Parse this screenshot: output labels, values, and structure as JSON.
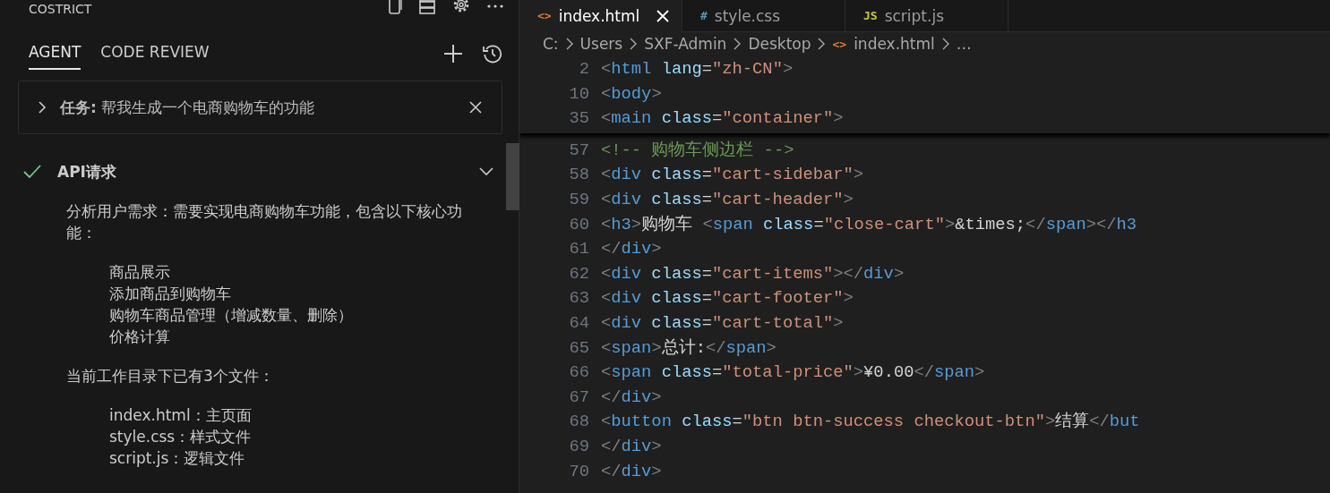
{
  "agent_panel": {
    "title": "COSTRICT",
    "tabs": [
      {
        "label": "AGENT",
        "selected": true
      },
      {
        "label": "CODE REVIEW",
        "selected": false
      }
    ],
    "task": {
      "expanded": false,
      "text": "**任务:** 帮我生成一个电商购物车的功能"
    },
    "section": {
      "title": "API请求",
      "completed": true,
      "expanded": true,
      "blocks": [
        {
          "kind": "paragraph",
          "text": "分析用户需求：需要实现电商购物车功能，包含以下核心功能："
        },
        {
          "kind": "list",
          "items": [
            "商品展示",
            "添加商品到购物车",
            "购物车商品管理（增减数量、删除）",
            "价格计算"
          ]
        },
        {
          "kind": "paragraph",
          "text": "当前工作目录下已有3个文件："
        },
        {
          "kind": "list",
          "items": [
            "index.html：主页面",
            "style.css：样式文件",
            "script.js：逻辑文件"
          ]
        }
      ]
    }
  },
  "editor": {
    "tabs": [
      {
        "label": "index.html",
        "kind": "html",
        "icon": "<>",
        "selected": true
      },
      {
        "label": "style.css",
        "kind": "css",
        "icon": "#",
        "selected": false
      },
      {
        "label": "script.js",
        "kind": "js",
        "icon": "JS",
        "selected": false
      }
    ],
    "breadcrumb": [
      {
        "text": "C:",
        "kind": "folder"
      },
      {
        "text": "Users",
        "kind": "folder"
      },
      {
        "text": "SXF-Admin",
        "kind": "folder"
      },
      {
        "text": "Desktop",
        "kind": "folder"
      },
      {
        "text": "index.html",
        "kind": "file",
        "icon": "<>"
      },
      {
        "text": "…",
        "kind": "more"
      }
    ],
    "sticky_lines": [
      {
        "number": "2",
        "tokens": [
          {
            "kind": "punct",
            "text": "<"
          },
          {
            "kind": "tag",
            "text": "html"
          },
          {
            "kind": "attr",
            "text": " lang"
          },
          {
            "kind": "text",
            "text": "="
          },
          {
            "kind": "string",
            "text": "\"zh-CN\""
          },
          {
            "kind": "punct",
            "text": ">"
          }
        ]
      },
      {
        "number": "10",
        "tokens": [
          {
            "kind": "punct",
            "text": "<"
          },
          {
            "kind": "tag",
            "text": "body"
          },
          {
            "kind": "punct",
            "text": ">"
          }
        ]
      },
      {
        "number": "35",
        "tokens": [
          {
            "kind": "punct",
            "text": "    <"
          },
          {
            "kind": "tag",
            "text": "main"
          },
          {
            "kind": "attr",
            "text": " class"
          },
          {
            "kind": "text",
            "text": "="
          },
          {
            "kind": "string",
            "text": "\"container\""
          },
          {
            "kind": "punct",
            "text": ">"
          }
        ]
      }
    ],
    "lines": [
      {
        "number": "57",
        "tokens": [
          {
            "kind": "comment",
            "text": "        <!-- 购物车侧边栏 -->"
          }
        ]
      },
      {
        "number": "58",
        "tokens": [
          {
            "kind": "punct",
            "text": "        <"
          },
          {
            "kind": "tag",
            "text": "div"
          },
          {
            "kind": "attr",
            "text": " class"
          },
          {
            "kind": "text",
            "text": "="
          },
          {
            "kind": "string",
            "text": "\"cart-sidebar\""
          },
          {
            "kind": "punct",
            "text": ">"
          }
        ]
      },
      {
        "number": "59",
        "tokens": [
          {
            "kind": "punct",
            "text": "            <"
          },
          {
            "kind": "tag",
            "text": "div"
          },
          {
            "kind": "attr",
            "text": " class"
          },
          {
            "kind": "text",
            "text": "="
          },
          {
            "kind": "string",
            "text": "\"cart-header\""
          },
          {
            "kind": "punct",
            "text": ">"
          }
        ]
      },
      {
        "number": "60",
        "tokens": [
          {
            "kind": "punct",
            "text": "                <"
          },
          {
            "kind": "tag",
            "text": "h3"
          },
          {
            "kind": "punct",
            "text": ">"
          },
          {
            "kind": "text",
            "text": "购物车 "
          },
          {
            "kind": "punct",
            "text": "<"
          },
          {
            "kind": "tag",
            "text": "span"
          },
          {
            "kind": "attr",
            "text": " class"
          },
          {
            "kind": "text",
            "text": "="
          },
          {
            "kind": "string",
            "text": "\"close-cart\""
          },
          {
            "kind": "punct",
            "text": ">"
          },
          {
            "kind": "entity",
            "text": "&times;"
          },
          {
            "kind": "punct",
            "text": "</"
          },
          {
            "kind": "tag",
            "text": "span"
          },
          {
            "kind": "punct",
            "text": "></"
          },
          {
            "kind": "tag",
            "text": "h3"
          }
        ]
      },
      {
        "number": "61",
        "tokens": [
          {
            "kind": "punct",
            "text": "            </"
          },
          {
            "kind": "tag",
            "text": "div"
          },
          {
            "kind": "punct",
            "text": ">"
          }
        ]
      },
      {
        "number": "62",
        "tokens": [
          {
            "kind": "punct",
            "text": "            <"
          },
          {
            "kind": "tag",
            "text": "div"
          },
          {
            "kind": "attr",
            "text": " class"
          },
          {
            "kind": "text",
            "text": "="
          },
          {
            "kind": "string",
            "text": "\"cart-items\""
          },
          {
            "kind": "punct",
            "text": "></"
          },
          {
            "kind": "tag",
            "text": "div"
          },
          {
            "kind": "punct",
            "text": ">"
          }
        ]
      },
      {
        "number": "63",
        "tokens": [
          {
            "kind": "punct",
            "text": "            <"
          },
          {
            "kind": "tag",
            "text": "div"
          },
          {
            "kind": "attr",
            "text": " class"
          },
          {
            "kind": "text",
            "text": "="
          },
          {
            "kind": "string",
            "text": "\"cart-footer\""
          },
          {
            "kind": "punct",
            "text": ">"
          }
        ]
      },
      {
        "number": "64",
        "tokens": [
          {
            "kind": "punct",
            "text": "                <"
          },
          {
            "kind": "tag",
            "text": "div"
          },
          {
            "kind": "attr",
            "text": " class"
          },
          {
            "kind": "text",
            "text": "="
          },
          {
            "kind": "string",
            "text": "\"cart-total\""
          },
          {
            "kind": "punct",
            "text": ">"
          }
        ]
      },
      {
        "number": "65",
        "tokens": [
          {
            "kind": "punct",
            "text": "                    <"
          },
          {
            "kind": "tag",
            "text": "span"
          },
          {
            "kind": "punct",
            "text": ">"
          },
          {
            "kind": "text",
            "text": "总计:"
          },
          {
            "kind": "punct",
            "text": "</"
          },
          {
            "kind": "tag",
            "text": "span"
          },
          {
            "kind": "punct",
            "text": ">"
          }
        ]
      },
      {
        "number": "66",
        "tokens": [
          {
            "kind": "punct",
            "text": "                    <"
          },
          {
            "kind": "tag",
            "text": "span"
          },
          {
            "kind": "attr",
            "text": " class"
          },
          {
            "kind": "text",
            "text": "="
          },
          {
            "kind": "string",
            "text": "\"total-price\""
          },
          {
            "kind": "punct",
            "text": ">"
          },
          {
            "kind": "text",
            "text": "¥0.00"
          },
          {
            "kind": "punct",
            "text": "</"
          },
          {
            "kind": "tag",
            "text": "span"
          },
          {
            "kind": "punct",
            "text": ">"
          }
        ]
      },
      {
        "number": "67",
        "tokens": [
          {
            "kind": "punct",
            "text": "                </"
          },
          {
            "kind": "tag",
            "text": "div"
          },
          {
            "kind": "punct",
            "text": ">"
          }
        ]
      },
      {
        "number": "68",
        "tokens": [
          {
            "kind": "punct",
            "text": "                <"
          },
          {
            "kind": "tag",
            "text": "button"
          },
          {
            "kind": "attr",
            "text": " class"
          },
          {
            "kind": "text",
            "text": "="
          },
          {
            "kind": "string",
            "text": "\"btn btn-success checkout-btn\""
          },
          {
            "kind": "punct",
            "text": ">"
          },
          {
            "kind": "text",
            "text": "结算"
          },
          {
            "kind": "punct",
            "text": "</"
          },
          {
            "kind": "tag",
            "text": "but"
          }
        ]
      },
      {
        "number": "69",
        "tokens": [
          {
            "kind": "punct",
            "text": "            </"
          },
          {
            "kind": "tag",
            "text": "div"
          },
          {
            "kind": "punct",
            "text": ">"
          }
        ]
      },
      {
        "number": "70",
        "tokens": [
          {
            "kind": "punct",
            "text": "        </"
          },
          {
            "kind": "tag",
            "text": "div"
          },
          {
            "kind": "punct",
            "text": ">"
          }
        ]
      }
    ]
  }
}
